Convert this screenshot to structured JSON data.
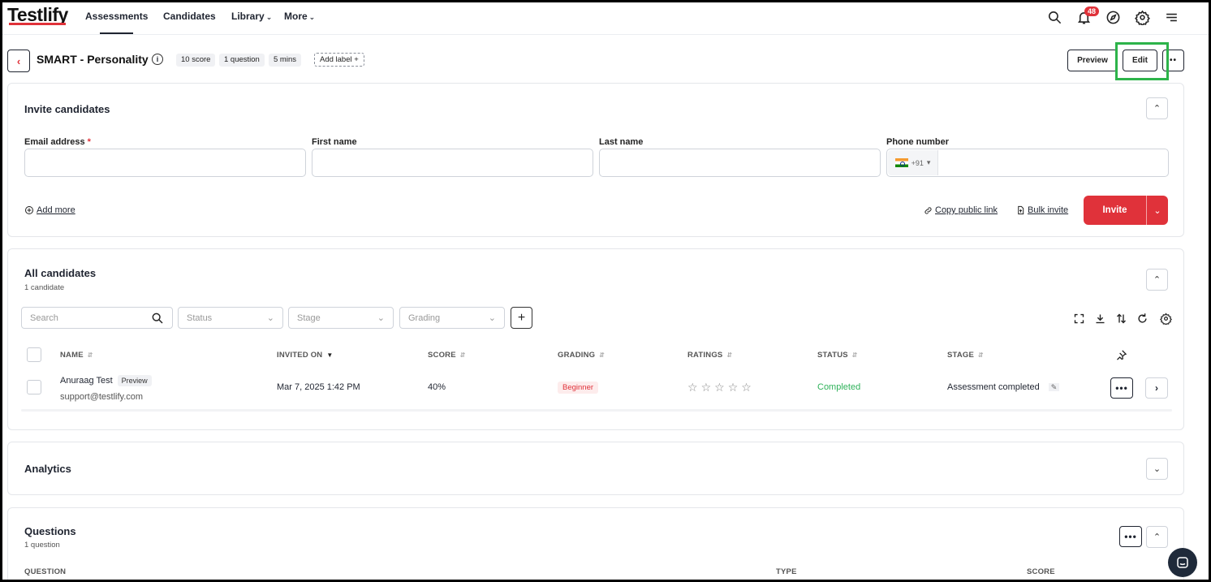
{
  "nav": {
    "logo": "Testlify",
    "items": [
      {
        "label": "Assessments",
        "active": true
      },
      {
        "label": "Candidates",
        "active": false
      },
      {
        "label": "Library",
        "has_menu": true
      },
      {
        "label": "More",
        "has_menu": true
      }
    ],
    "notification_count": "48",
    "icons": [
      "search-icon",
      "bell-icon",
      "compass-icon",
      "gear-icon",
      "hamburger-icon"
    ]
  },
  "header": {
    "back": "‹",
    "title": "SMART - Personality",
    "chips": [
      "10 score",
      "1 question",
      "5 mins"
    ],
    "add_label": "Add label",
    "preview_label": "Preview",
    "edit_label": "Edit",
    "more_label": "••"
  },
  "invite": {
    "title": "Invite candidates",
    "fields": {
      "email_label": "Email address",
      "email_required": "*",
      "first_name_label": "First name",
      "last_name_label": "Last name",
      "phone_label": "Phone number",
      "phone_prefix": "+91"
    },
    "add_more": "Add more",
    "copy_public_link": "Copy public link",
    "bulk_invite": "Bulk invite",
    "invite_button": "Invite"
  },
  "candidates": {
    "title": "All candidates",
    "count_label": "1 candidate",
    "search_placeholder": "Search",
    "filters": [
      "Status",
      "Stage",
      "Grading"
    ],
    "columns": [
      "NAME",
      "INVITED ON",
      "SCORE",
      "GRADING",
      "RATINGS",
      "STATUS",
      "STAGE"
    ],
    "rows": [
      {
        "name": "Anuraag Test",
        "preview_tag": "Preview",
        "email": "support@testlify.com",
        "invited_on": "Mar 7, 2025 1:42 PM",
        "score": "40%",
        "grading": "Beginner",
        "rating": 0,
        "status": "Completed",
        "stage": "Assessment completed",
        "more": "•••",
        "open": "›"
      }
    ]
  },
  "analytics": {
    "title": "Analytics"
  },
  "questions": {
    "title": "Questions",
    "count_label": "1 question",
    "columns": [
      "QUESTION",
      "TYPE",
      "SCORE"
    ],
    "more": "•••"
  },
  "colors": {
    "accent": "#e0323a",
    "success": "#2fb25a",
    "highlight": "#2db34a"
  }
}
